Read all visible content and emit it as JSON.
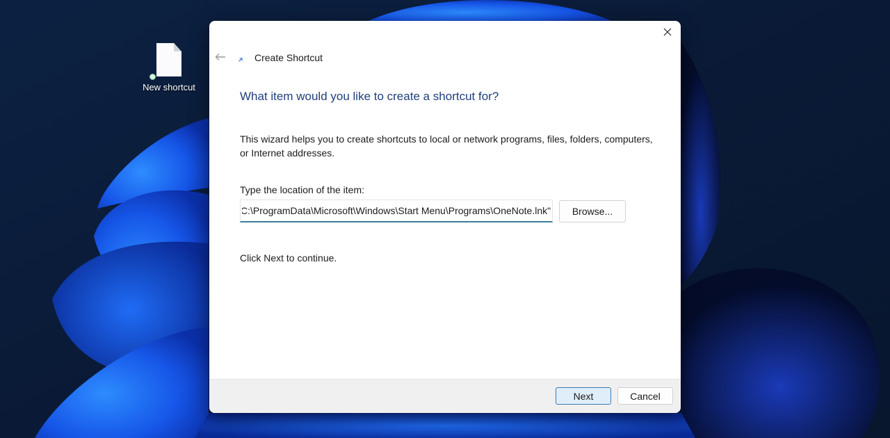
{
  "desktop": {
    "icons": [
      {
        "label": "New shortcut",
        "icon": "blank-file-icon",
        "selected": true
      }
    ],
    "wallpaper": "windows-11-bloom-dark"
  },
  "dialog": {
    "title": "Create Shortcut",
    "title_icon": "shortcut-arrow-icon",
    "back_icon": "back-arrow-icon",
    "close_icon": "close-icon",
    "heading": "What item would you like to create a shortcut for?",
    "description": "This wizard helps you to create shortcuts to local or network programs, files, folders, computers, or Internet addresses.",
    "location_label": "Type the location of the item:",
    "location_value": "\"C:\\ProgramData\\Microsoft\\Windows\\Start Menu\\Programs\\OneNote.lnk\"",
    "browse_label": "Browse...",
    "continue_text": "Click Next to continue.",
    "next_label": "Next",
    "cancel_label": "Cancel"
  },
  "colors": {
    "heading": "#1f3f7a",
    "input_underline": "#3b7a9c",
    "next_border": "#3d7ab3",
    "next_bg": "#e0eef9",
    "footer_bg": "#f0f0f0"
  }
}
